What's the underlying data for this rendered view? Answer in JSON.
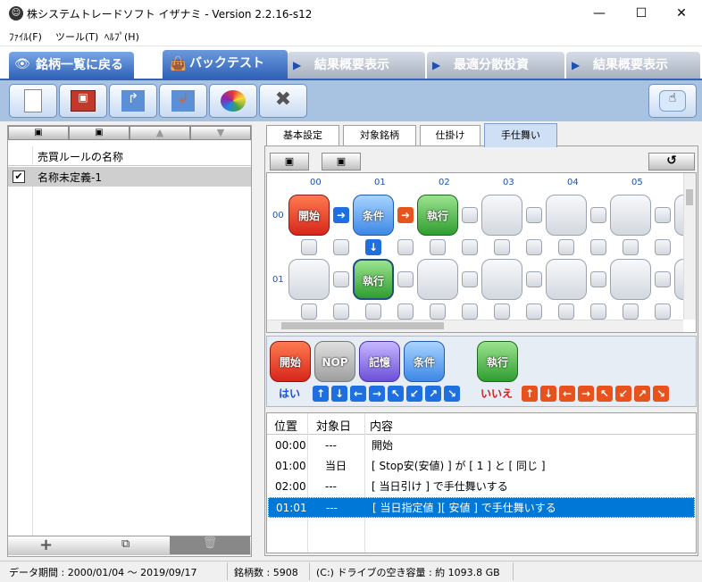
{
  "window": {
    "title": "株システムトレードソフト イザナミ - Version 2.2.16-s12",
    "minimize": "—",
    "maximize": "☐",
    "close": "✕"
  },
  "menu": [
    {
      "label": "ﾌｧｲﾙ(F)"
    },
    {
      "label": "ツール(T)"
    },
    {
      "label": "ﾍﾙﾌﾟ(H)"
    }
  ],
  "main_tabs": [
    {
      "label": "銘柄一覧に戻る"
    },
    {
      "label": "バックテスト"
    },
    {
      "label": "結果概要表示"
    },
    {
      "label": "最適分散投資"
    },
    {
      "label": "結果概要表示"
    }
  ],
  "left": {
    "column_header": "売買ルールの名称",
    "rules": [
      {
        "checked": "✔",
        "name": "名称未定義-1"
      }
    ]
  },
  "subtabs": [
    {
      "label": "基本設定"
    },
    {
      "label": "対象銘柄"
    },
    {
      "label": "仕掛け"
    },
    {
      "label": "手仕舞い"
    }
  ],
  "grid": {
    "cols": [
      "00",
      "01",
      "02",
      "03",
      "04",
      "05"
    ],
    "rows": [
      "00",
      "01"
    ],
    "nodes": {
      "start": "開始",
      "cond": "条件",
      "exec1": "執行",
      "exec2": "執行"
    }
  },
  "palette": {
    "start": "開始",
    "nop": "NOP",
    "memo": "記憶",
    "cond": "条件",
    "exec": "執行",
    "yes": "はい",
    "no": "いいえ"
  },
  "table": {
    "headers": [
      "位置",
      "対象日",
      "内容"
    ],
    "rows": [
      {
        "pos": "00:00",
        "day": "---",
        "content": "開始"
      },
      {
        "pos": "01:00",
        "day": "当日",
        "content": "[ Stop安(安値) ] が [ 1 ] と [ 同じ ]"
      },
      {
        "pos": "02:00",
        "day": "---",
        "content": "[ 当日引け ] で手仕舞いする"
      },
      {
        "pos": "01:01",
        "day": "---",
        "content": "[ 当日指定値 ][ 安値 ] で手仕舞いする"
      }
    ]
  },
  "status": {
    "period": "データ期間 : 2000/01/04 〜 2019/09/17",
    "stocks": "銘柄数 : 5908",
    "disk": "(C:) ドライブの空き容量 : 約 1093.8 GB"
  },
  "colors": {
    "accent": "#2f62b8",
    "selection": "#0078d7"
  }
}
